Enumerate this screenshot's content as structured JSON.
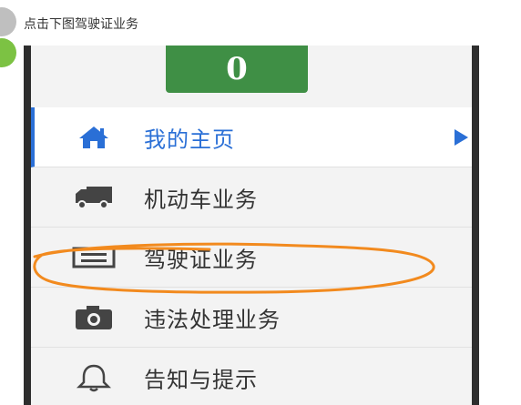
{
  "caption": "点击下图驾驶证业务",
  "header": {
    "badge_value": "0"
  },
  "menu": {
    "items": [
      {
        "label": "我的主页",
        "icon": "home-icon",
        "active": true
      },
      {
        "label": "机动车业务",
        "icon": "truck-icon"
      },
      {
        "label": "驾驶证业务",
        "icon": "license-card-icon"
      },
      {
        "label": "违法处理业务",
        "icon": "camera-icon"
      },
      {
        "label": "告知与提示",
        "icon": "bell-icon"
      }
    ]
  },
  "colors": {
    "accent": "#2a6fd6",
    "green": "#3f8f45",
    "annotation": "#f28a1e",
    "step_green": "#7cc243",
    "step_gray": "#bfbfbf"
  }
}
